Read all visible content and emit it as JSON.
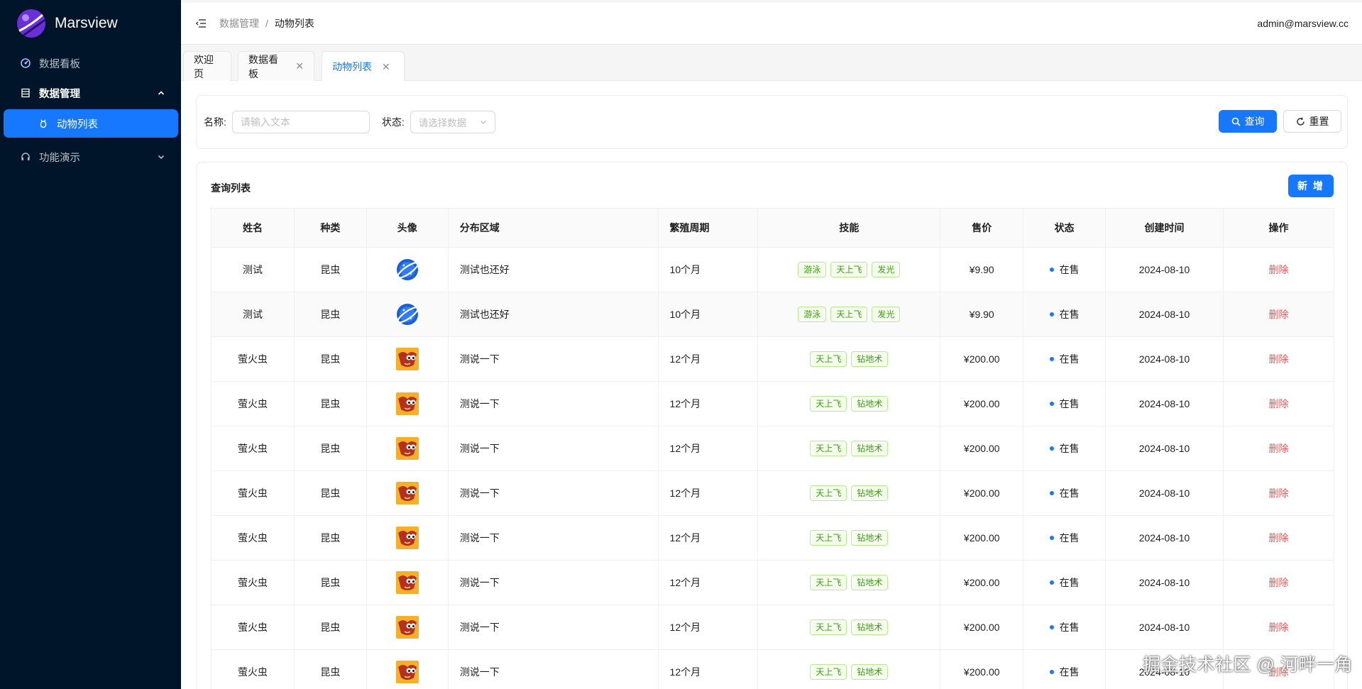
{
  "app": {
    "name": "Marsview",
    "colors": {
      "sidebar_bg": "#001529",
      "primary": "#1677ff",
      "danger": "#ff4d4f",
      "tag_green": "#389e0d",
      "logo": "#6a2fd6"
    }
  },
  "sidebar": {
    "items": [
      {
        "label": "数据看板",
        "icon": "dashboard-icon"
      },
      {
        "label": "数据管理",
        "icon": "database-icon",
        "expanded": true,
        "children": [
          {
            "label": "动物列表",
            "icon": "bug-icon",
            "active": true
          }
        ]
      },
      {
        "label": "功能演示",
        "icon": "headphones-icon",
        "expanded": false
      }
    ]
  },
  "header": {
    "breadcrumb": [
      "数据管理",
      "动物列表"
    ],
    "breadcrumb_separator": "/",
    "user_email": "admin@marsview.cc"
  },
  "tabs": [
    {
      "label": "欢迎页",
      "closable": false,
      "active": false
    },
    {
      "label": "数据看板",
      "closable": true,
      "active": false
    },
    {
      "label": "动物列表",
      "closable": true,
      "active": true
    }
  ],
  "search": {
    "name_label": "名称:",
    "name_placeholder": "请输入文本",
    "status_label": "状态:",
    "status_placeholder": "请选择数据",
    "query_button": "查询",
    "reset_button": "重置"
  },
  "list": {
    "title": "查询列表",
    "add_button": "新 增",
    "columns": [
      "姓名",
      "种类",
      "头像",
      "分布区域",
      "繁殖周期",
      "技能",
      "售价",
      "状态",
      "创建时间",
      "操作"
    ],
    "rows": [
      {
        "name": "测试",
        "kind": "昆虫",
        "avatar": "planet-avatar",
        "region": "测试也还好",
        "cycle": "10个月",
        "skills": [
          "游泳",
          "天上飞",
          "发光"
        ],
        "price": "¥9.90",
        "status": "在售",
        "created": "2024-08-10",
        "action": "删除"
      },
      {
        "name": "测试",
        "kind": "昆虫",
        "avatar": "planet-avatar",
        "region": "测试也还好",
        "cycle": "10个月",
        "skills": [
          "游泳",
          "天上飞",
          "发光"
        ],
        "price": "¥9.90",
        "status": "在售",
        "created": "2024-08-10",
        "action": "删除"
      },
      {
        "name": "萤火虫",
        "kind": "昆虫",
        "avatar": "creature-avatar",
        "region": "测说一下",
        "cycle": "12个月",
        "skills": [
          "天上飞",
          "钻地术"
        ],
        "price": "¥200.00",
        "status": "在售",
        "created": "2024-08-10",
        "action": "删除"
      },
      {
        "name": "萤火虫",
        "kind": "昆虫",
        "avatar": "creature-avatar",
        "region": "测说一下",
        "cycle": "12个月",
        "skills": [
          "天上飞",
          "钻地术"
        ],
        "price": "¥200.00",
        "status": "在售",
        "created": "2024-08-10",
        "action": "删除"
      },
      {
        "name": "萤火虫",
        "kind": "昆虫",
        "avatar": "creature-avatar",
        "region": "测说一下",
        "cycle": "12个月",
        "skills": [
          "天上飞",
          "钻地术"
        ],
        "price": "¥200.00",
        "status": "在售",
        "created": "2024-08-10",
        "action": "删除"
      },
      {
        "name": "萤火虫",
        "kind": "昆虫",
        "avatar": "creature-avatar",
        "region": "测说一下",
        "cycle": "12个月",
        "skills": [
          "天上飞",
          "钻地术"
        ],
        "price": "¥200.00",
        "status": "在售",
        "created": "2024-08-10",
        "action": "删除"
      },
      {
        "name": "萤火虫",
        "kind": "昆虫",
        "avatar": "creature-avatar",
        "region": "测说一下",
        "cycle": "12个月",
        "skills": [
          "天上飞",
          "钻地术"
        ],
        "price": "¥200.00",
        "status": "在售",
        "created": "2024-08-10",
        "action": "删除"
      },
      {
        "name": "萤火虫",
        "kind": "昆虫",
        "avatar": "creature-avatar",
        "region": "测说一下",
        "cycle": "12个月",
        "skills": [
          "天上飞",
          "钻地术"
        ],
        "price": "¥200.00",
        "status": "在售",
        "created": "2024-08-10",
        "action": "删除"
      },
      {
        "name": "萤火虫",
        "kind": "昆虫",
        "avatar": "creature-avatar",
        "region": "测说一下",
        "cycle": "12个月",
        "skills": [
          "天上飞",
          "钻地术"
        ],
        "price": "¥200.00",
        "status": "在售",
        "created": "2024-08-10",
        "action": "删除"
      },
      {
        "name": "萤火虫",
        "kind": "昆虫",
        "avatar": "creature-avatar",
        "region": "测说一下",
        "cycle": "12个月",
        "skills": [
          "天上飞",
          "钻地术"
        ],
        "price": "¥200.00",
        "status": "在售",
        "created": "2024-08-10",
        "action": "删除"
      }
    ]
  },
  "watermark": "掘金技术社区 @ 河畔一角"
}
